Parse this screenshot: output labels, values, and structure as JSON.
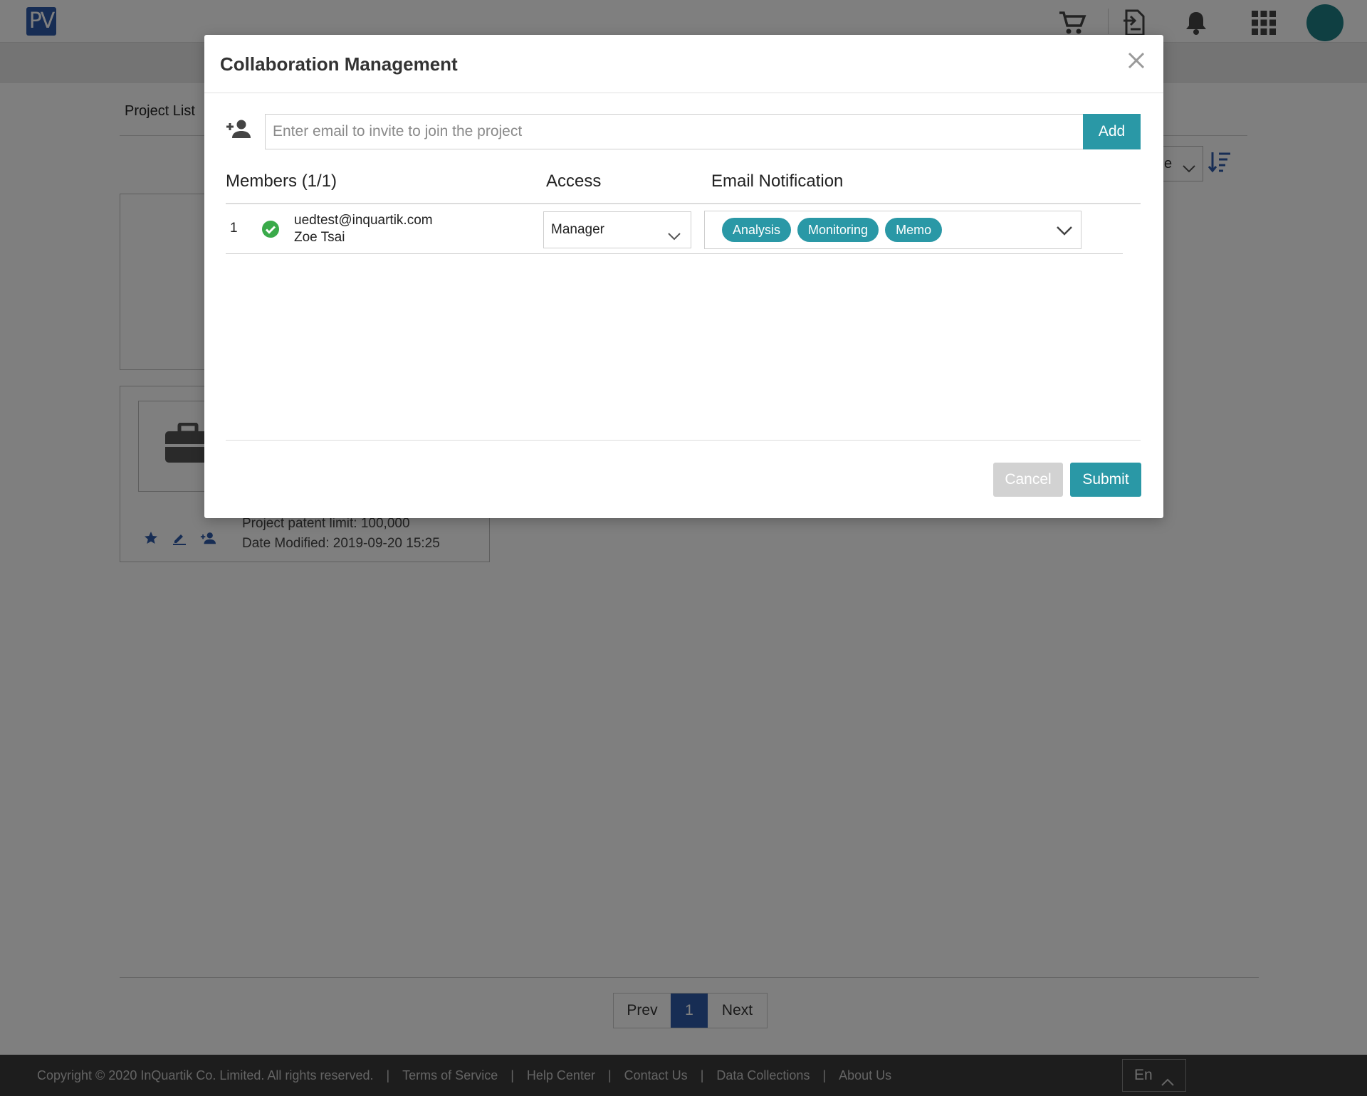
{
  "app": {
    "logo_text": "PV",
    "colors": {
      "brand": "#2f5aa8",
      "accent": "#2a98a6",
      "success": "#3aaa4a",
      "avatar": "#1e7f85"
    }
  },
  "topbar": {
    "icons": [
      "cart-icon",
      "file-export-icon",
      "bell-icon",
      "apps-grid-icon",
      "avatar"
    ]
  },
  "page": {
    "tab_label": "Project List",
    "sort_select_value": "e",
    "cards": [
      {
        "limit_text": "Project patent limit: 100,000",
        "date_text": "Date Modified: 2019-09-20 15:25"
      }
    ],
    "pagination": {
      "prev": "Prev",
      "current": "1",
      "next": "Next"
    }
  },
  "footer": {
    "copyright": "Copyright © 2020 InQuartik Co. Limited. All rights reserved.",
    "links": [
      "Terms of Service",
      "Help Center",
      "Contact Us",
      "Data Collections",
      "About Us"
    ],
    "language": "En"
  },
  "modal": {
    "title": "Collaboration Management",
    "invite": {
      "placeholder": "Enter email to invite to join the project",
      "add_label": "Add"
    },
    "table": {
      "members_header": "Members (1/1)",
      "access_header": "Access",
      "email_header": "Email Notification",
      "rows": [
        {
          "index": "1",
          "email": "uedtest@inquartik.com",
          "name": "Zoe Tsai",
          "access": "Manager",
          "notifications": [
            "Analysis",
            "Monitoring",
            "Memo"
          ]
        }
      ]
    },
    "cancel_label": "Cancel",
    "submit_label": "Submit"
  }
}
